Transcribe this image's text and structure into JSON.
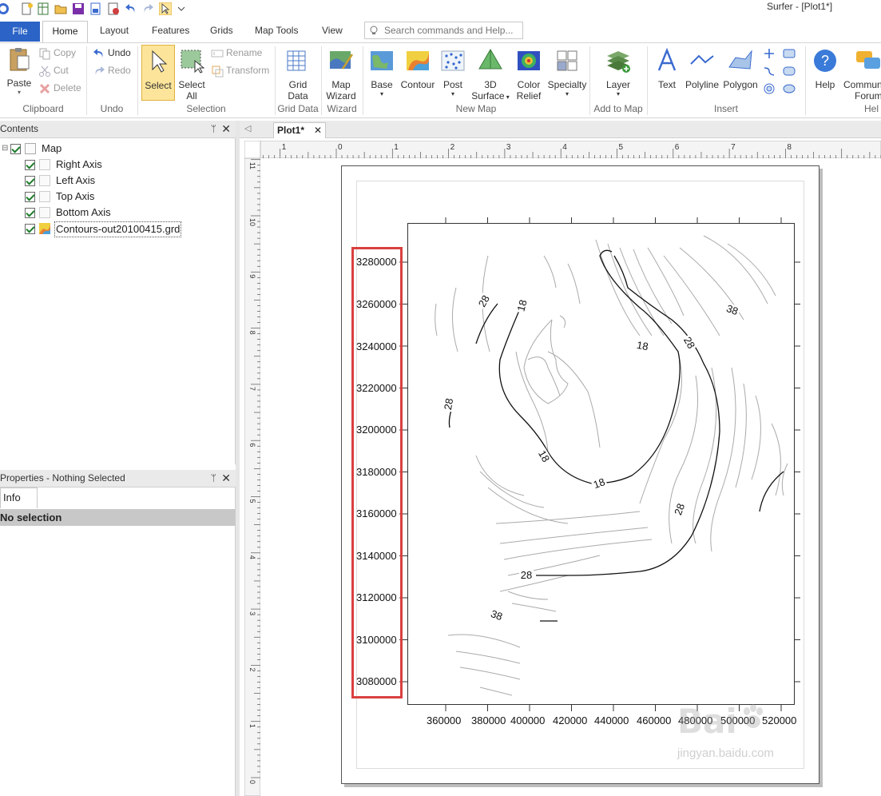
{
  "window": {
    "title": "Surfer - [Plot1*]"
  },
  "ribbon_tabs": [
    "File",
    "Home",
    "Layout",
    "Features",
    "Grids",
    "Map Tools",
    "View"
  ],
  "search": {
    "placeholder": "Search commands and Help..."
  },
  "ribbon": {
    "clipboard": {
      "paste": "Paste",
      "copy": "Copy",
      "cut": "Cut",
      "delete": "Delete",
      "label": "Clipboard"
    },
    "undo": {
      "undo": "Undo",
      "redo": "Redo",
      "label": "Undo"
    },
    "selection": {
      "select": "Select",
      "select_all_1": "Select",
      "select_all_2": "All",
      "rename": "Rename",
      "transform": "Transform",
      "label": "Selection"
    },
    "grid_data": {
      "line1": "Grid",
      "line2": "Data",
      "label": "Grid Data"
    },
    "wizard": {
      "line1": "Map",
      "line2": "Wizard",
      "label": "Wizard"
    },
    "new_map": {
      "base": "Base",
      "contour": "Contour",
      "post": "Post",
      "surface1": "3D",
      "surface2": "Surface",
      "relief1": "Color",
      "relief2": "Relief",
      "specialty": "Specialty",
      "label": "New Map"
    },
    "add_to_map": {
      "layer": "Layer",
      "label": "Add to Map"
    },
    "insert": {
      "text": "Text",
      "polyline": "Polyline",
      "polygon": "Polygon",
      "label": "Insert"
    },
    "help": {
      "help": "Help",
      "community1": "Commun",
      "community2": "Forum",
      "label": "Hel"
    }
  },
  "contents_panel": {
    "title": "Contents",
    "items": [
      "Map",
      "Right Axis",
      "Left Axis",
      "Top Axis",
      "Bottom Axis",
      "Contours-out20100415.grd"
    ]
  },
  "properties_panel": {
    "title": "Properties - Nothing Selected",
    "tab": "Info",
    "status": "No selection"
  },
  "document": {
    "tab": "Plot1*",
    "ruler_h": [
      "1",
      "0",
      "1",
      "2",
      "3",
      "4",
      "5",
      "6",
      "7",
      "8"
    ],
    "ruler_v": [
      "11",
      "10",
      "9",
      "8",
      "7",
      "6",
      "5",
      "4",
      "3",
      "2",
      "1",
      "0"
    ]
  },
  "map": {
    "y_labels": [
      "3280000",
      "3260000",
      "3240000",
      "3220000",
      "3200000",
      "3180000",
      "3160000",
      "3140000",
      "3120000",
      "3100000",
      "3080000"
    ],
    "x_labels": [
      "360000",
      "380000",
      "400000",
      "420000",
      "440000",
      "460000",
      "480000",
      "500000",
      "520000"
    ],
    "contour_labels": [
      "28",
      "18",
      "38",
      "18",
      "28",
      "28",
      "18",
      "18",
      "28",
      "28",
      "38"
    ]
  },
  "watermark": {
    "brand": "Bai",
    "site": "jingyan.baidu.com"
  },
  "colors": {
    "accent": "#2b63c6",
    "highlight": "#d94040",
    "select_active": "#fce59a"
  }
}
